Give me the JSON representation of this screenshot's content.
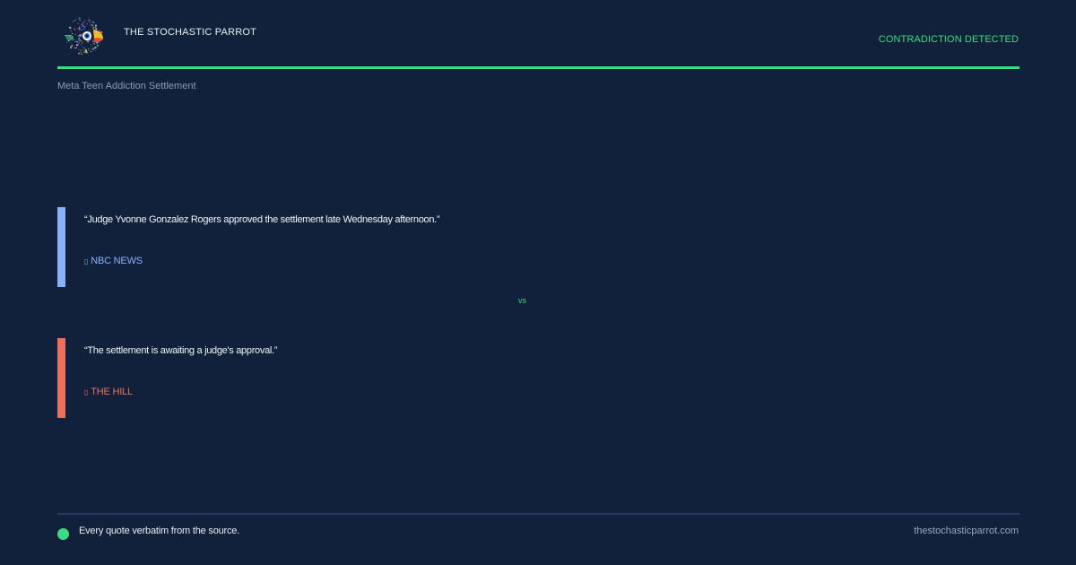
{
  "header": {
    "brand_name": "THE STOCHASTIC PARROT",
    "status_label": "CONTRADICTION DETECTED"
  },
  "topic": "Meta Teen Addiction Settlement",
  "comparison": {
    "first": {
      "quote": "“Judge Yvonne Gonzalez Rogers approved the settlement late Wednesday afternoon.”",
      "source": "NBC NEWS"
    },
    "separator": "vs",
    "second": {
      "quote": "“The settlement is awaiting a judge's approval.”",
      "source": "THE HILL"
    }
  },
  "footer": {
    "note": "Every quote verbatim from the source.",
    "site": "thestochasticparrot.com"
  },
  "icons": {
    "logo": "parrot-logo-icon",
    "source": "newspaper-icon",
    "footer_dot": "status-dot-icon"
  },
  "colors": {
    "background": "#11213c",
    "accent": "#3ddc84",
    "first_source": "#8ab2f7",
    "second_source": "#ee6f5f"
  }
}
